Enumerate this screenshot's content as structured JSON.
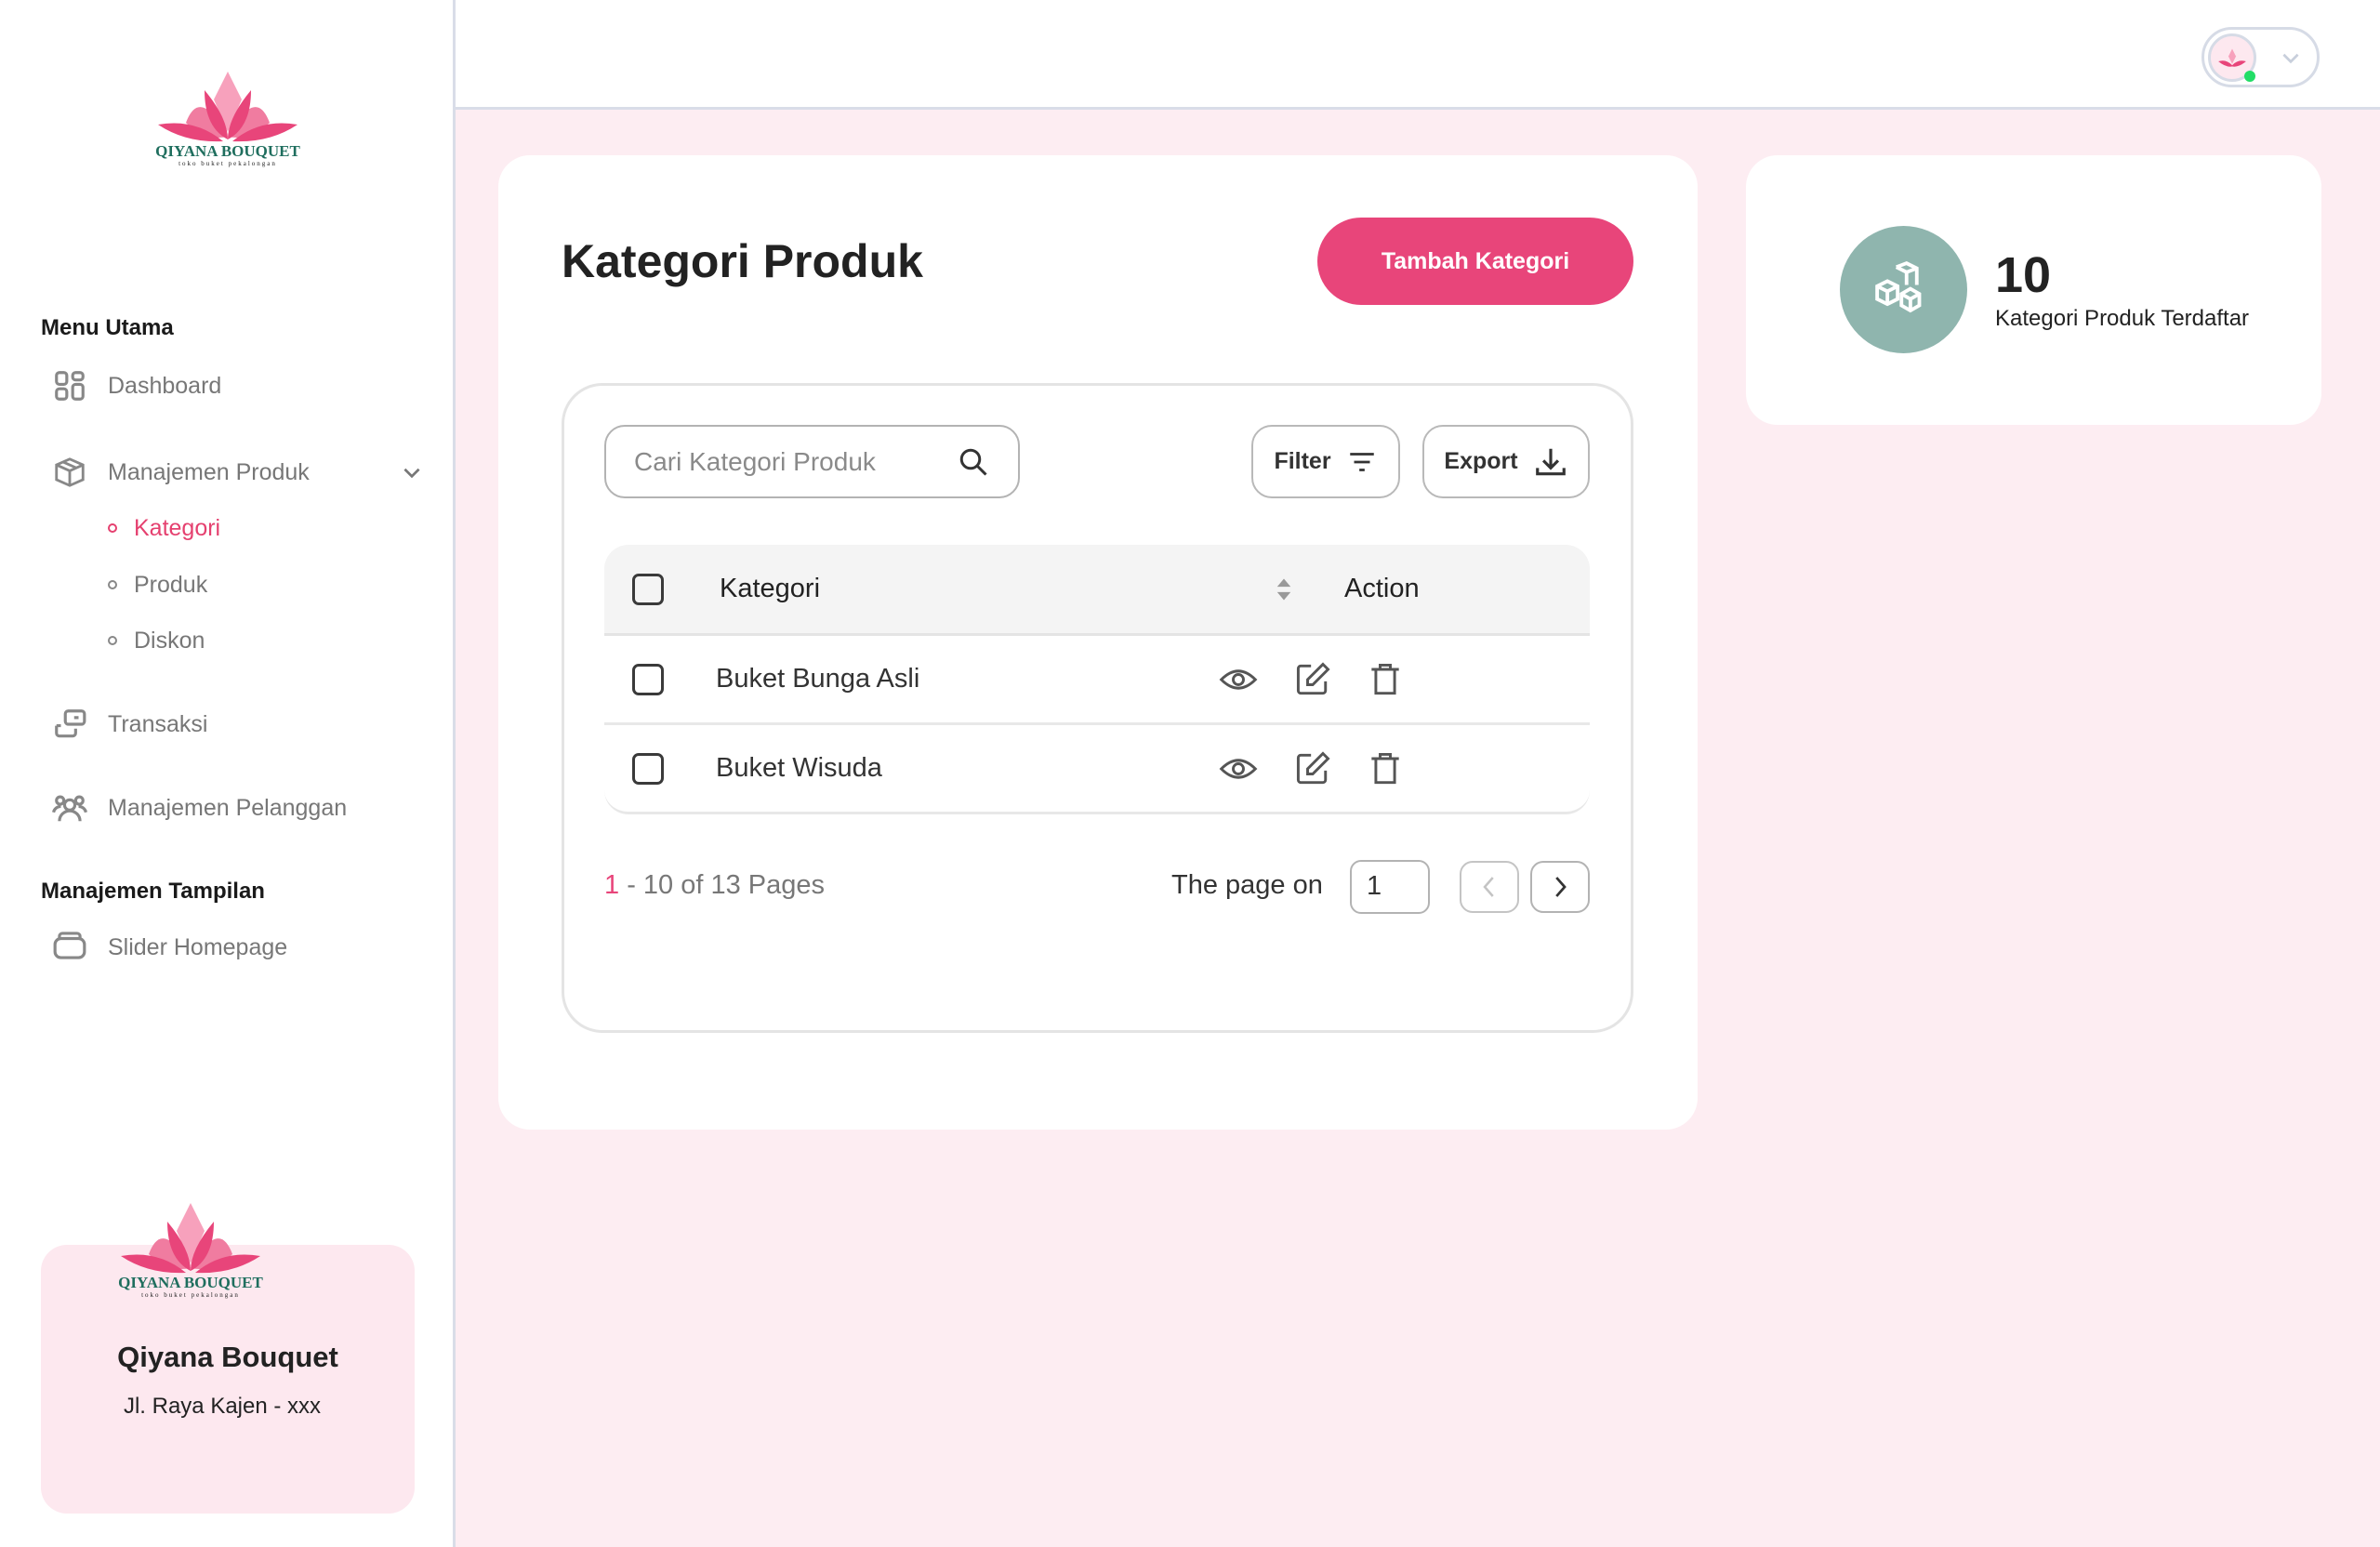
{
  "brand": {
    "name": "QIYANA BOUQUET",
    "tagline": "toko buket pekalongan"
  },
  "sidebar": {
    "section_main": "Menu Utama",
    "items": [
      {
        "label": "Dashboard",
        "icon": "grid-icon"
      },
      {
        "label": "Manajemen Produk",
        "icon": "box-icon",
        "expanded": true,
        "children": [
          {
            "label": "Kategori",
            "active": true
          },
          {
            "label": "Produk"
          },
          {
            "label": "Diskon"
          }
        ]
      },
      {
        "label": "Transaksi",
        "icon": "transaction-icon"
      },
      {
        "label": "Manajemen Pelanggan",
        "icon": "users-icon"
      }
    ],
    "section_display": "Manajemen Tampilan",
    "display_items": [
      {
        "label": "Slider Homepage",
        "icon": "slider-icon"
      }
    ],
    "store_card": {
      "name": "Qiyana Bouquet",
      "address": "Jl. Raya Kajen - xxx"
    }
  },
  "header": {
    "profile_status": "online"
  },
  "main": {
    "title": "Kategori Produk",
    "add_button": "Tambah Kategori",
    "search_placeholder": "Cari Kategori Produk",
    "filter_label": "Filter",
    "export_label": "Export",
    "table": {
      "columns": [
        "Kategori",
        "Action"
      ],
      "rows": [
        {
          "name": "Buket Bunga Asli"
        },
        {
          "name": "Buket Wisuda"
        }
      ]
    },
    "pagination": {
      "current": "1",
      "range_rest": " - 10 of 13 Pages",
      "page_label": "The page on",
      "page_value": "1"
    }
  },
  "stat": {
    "value": "10",
    "label": "Kategori Produk Terdaftar"
  },
  "colors": {
    "accent": "#e8457a",
    "stat_circle": "#8fb5ae",
    "background": "#fdedf2"
  }
}
